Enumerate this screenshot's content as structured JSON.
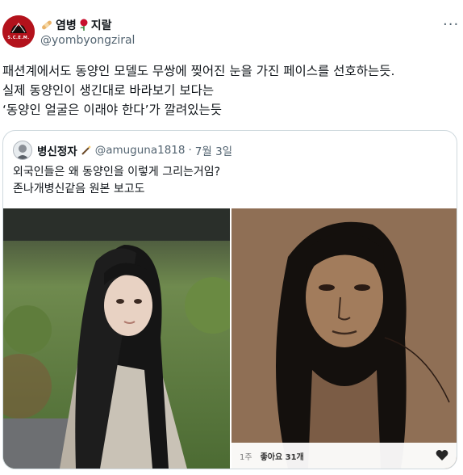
{
  "author": {
    "display_name": "염병",
    "display_name_suffix": "지랄",
    "handle": "@yombyongziral",
    "avatar_text": "S.C.E.M."
  },
  "tweet": {
    "text": "패션계에서도 동양인 모델도 무쌍에 찢어진 눈을 가진 페이스를 선호하는듯.\n실제 동양인이 생긴대로 바라보기 보다는\n‘동양인 얼굴은 이래야 한다’가 깔려있는듯"
  },
  "quoted": {
    "display_name": "병신정자",
    "handle": "@amuguna1818",
    "separator": "·",
    "date": "7월 3일",
    "text": "외국인들은 왜 동양인을 이렇게 그리는거임?\n존나개병신같음 원본 보고도",
    "image_footer": {
      "age": "1주",
      "likes": "좋아요 31개"
    }
  },
  "colors": {
    "text": "#0f1419",
    "secondary": "#536471",
    "border": "#cfd9de"
  },
  "icons": {
    "more": "more-dots-icon",
    "heart": "heart-icon",
    "bandage": "bandage-icon",
    "rose": "rose-icon",
    "wand": "wand-icon"
  }
}
